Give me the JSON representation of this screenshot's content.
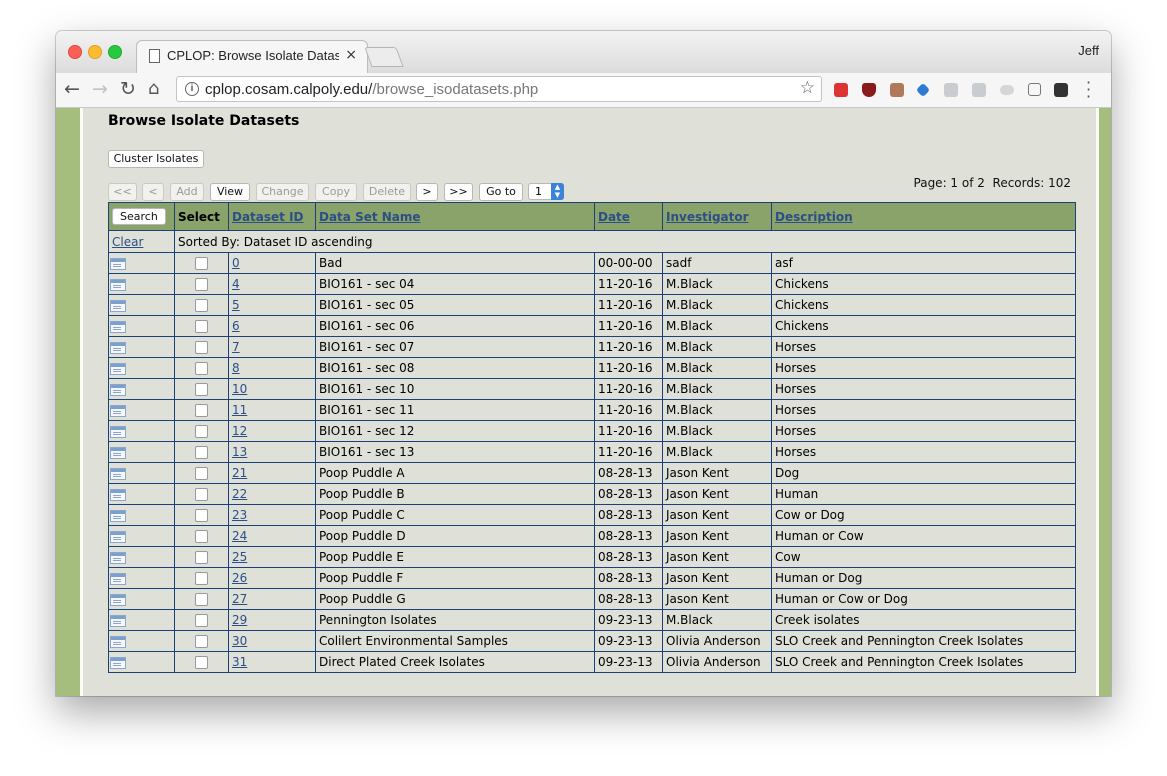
{
  "browser": {
    "tab_title": "CPLOP: Browse Isolate Datase",
    "tab_close": "×",
    "profile_name": "Jeff",
    "url_host": "cplop.cosam.calpoly.edu/",
    "url_path": "/browse_isodatasets.php"
  },
  "page": {
    "title": "Browse Isolate Datasets",
    "cluster_button": "Cluster Isolates",
    "pager": {
      "first": "<<",
      "prev": "<",
      "add": "Add",
      "view": "View",
      "change": "Change",
      "copy": "Copy",
      "delete": "Delete",
      "next": ">",
      "last": ">>",
      "goto": "Go to",
      "page_select": "1"
    },
    "page_info": "Page: 1 of 2  Records: 102"
  },
  "table": {
    "headers": {
      "search": "Search",
      "select": "Select",
      "dataset_id": "Dataset ID",
      "name": "Data Set Name",
      "date": "Date",
      "investigator": "Investigator",
      "description": "Description"
    },
    "clear": "Clear",
    "sorted_by": "Sorted By: Dataset ID ascending",
    "rows": [
      {
        "id": "0",
        "name": "Bad",
        "date": "00-00-00",
        "investigator": "sadf",
        "description": "asf"
      },
      {
        "id": "4",
        "name": "BIO161 - sec 04",
        "date": "11-20-16",
        "investigator": "M.Black",
        "description": "Chickens"
      },
      {
        "id": "5",
        "name": "BIO161 - sec 05",
        "date": "11-20-16",
        "investigator": "M.Black",
        "description": "Chickens"
      },
      {
        "id": "6",
        "name": "BIO161 - sec 06",
        "date": "11-20-16",
        "investigator": "M.Black",
        "description": "Chickens"
      },
      {
        "id": "7",
        "name": "BIO161 - sec 07",
        "date": "11-20-16",
        "investigator": "M.Black",
        "description": "Horses"
      },
      {
        "id": "8",
        "name": "BIO161 - sec 08",
        "date": "11-20-16",
        "investigator": "M.Black",
        "description": "Horses"
      },
      {
        "id": "10",
        "name": "BIO161 - sec 10",
        "date": "11-20-16",
        "investigator": "M.Black",
        "description": "Horses"
      },
      {
        "id": "11",
        "name": "BIO161 - sec 11",
        "date": "11-20-16",
        "investigator": "M.Black",
        "description": "Horses"
      },
      {
        "id": "12",
        "name": "BIO161 - sec 12",
        "date": "11-20-16",
        "investigator": "M.Black",
        "description": "Horses"
      },
      {
        "id": "13",
        "name": "BIO161 - sec 13",
        "date": "11-20-16",
        "investigator": "M.Black",
        "description": "Horses"
      },
      {
        "id": "21",
        "name": "Poop Puddle A",
        "date": "08-28-13",
        "investigator": "Jason Kent",
        "description": "Dog"
      },
      {
        "id": "22",
        "name": "Poop Puddle B",
        "date": "08-28-13",
        "investigator": "Jason Kent",
        "description": "Human"
      },
      {
        "id": "23",
        "name": "Poop Puddle C",
        "date": "08-28-13",
        "investigator": "Jason Kent",
        "description": "Cow or Dog"
      },
      {
        "id": "24",
        "name": "Poop Puddle D",
        "date": "08-28-13",
        "investigator": "Jason Kent",
        "description": "Human or Cow"
      },
      {
        "id": "25",
        "name": "Poop Puddle E",
        "date": "08-28-13",
        "investigator": "Jason Kent",
        "description": "Cow"
      },
      {
        "id": "26",
        "name": "Poop Puddle F",
        "date": "08-28-13",
        "investigator": "Jason Kent",
        "description": "Human or Dog"
      },
      {
        "id": "27",
        "name": "Poop Puddle G",
        "date": "08-28-13",
        "investigator": "Jason Kent",
        "description": "Human or Cow or Dog"
      },
      {
        "id": "29",
        "name": "Pennington Isolates",
        "date": "09-23-13",
        "investigator": "M.Black",
        "description": "Creek isolates"
      },
      {
        "id": "30",
        "name": "Colilert Environmental Samples",
        "date": "09-23-13",
        "investigator": "Olivia Anderson",
        "description": "SLO Creek and Pennington Creek Isolates"
      },
      {
        "id": "31",
        "name": "Direct Plated Creek Isolates",
        "date": "09-23-13",
        "investigator": "Olivia Anderson",
        "description": "SLO Creek and Pennington Creek Isolates"
      }
    ]
  }
}
